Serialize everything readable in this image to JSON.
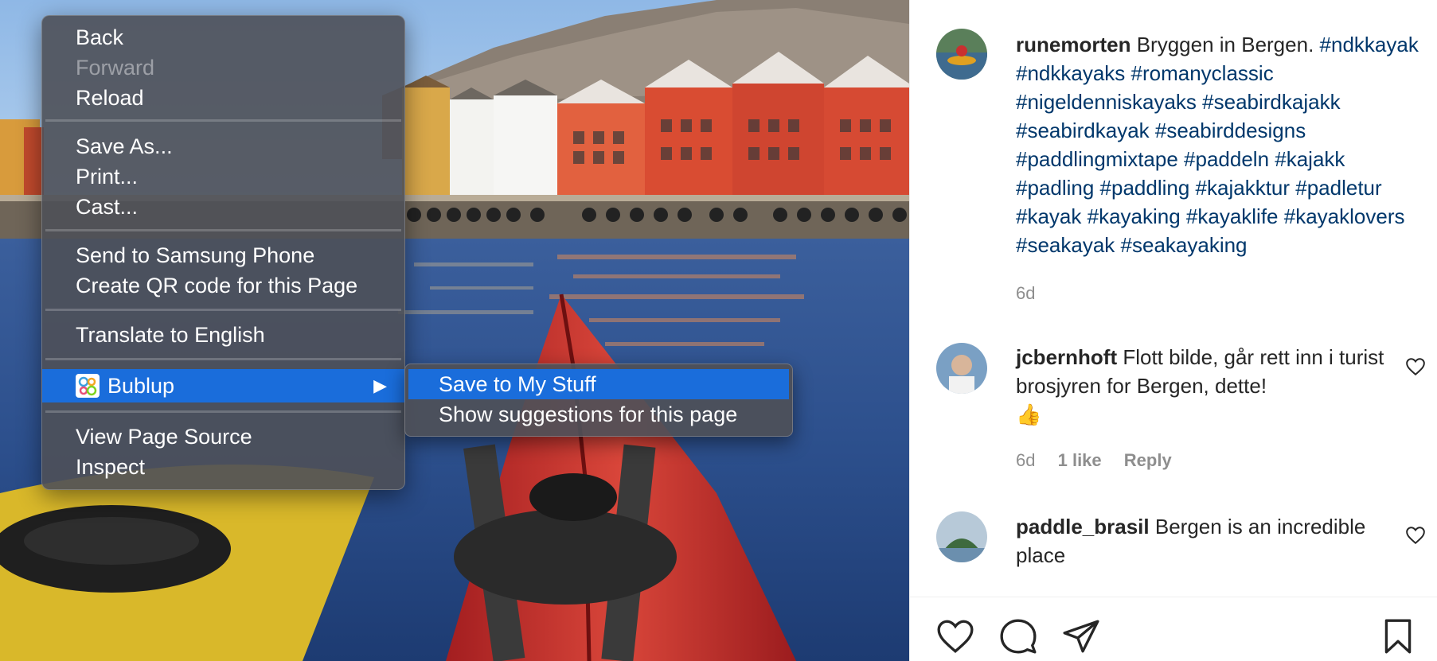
{
  "context_menu": {
    "items": [
      {
        "label": "Back"
      },
      {
        "label": "Forward"
      },
      {
        "label": "Reload"
      },
      {
        "label": "Save As..."
      },
      {
        "label": "Print..."
      },
      {
        "label": "Cast..."
      },
      {
        "label": "Send to Samsung Phone"
      },
      {
        "label": "Create QR code for this Page"
      },
      {
        "label": "Translate to English"
      },
      {
        "label": "Bublup",
        "icon": "bublup-logo-icon",
        "submenu_arrow": "▶"
      },
      {
        "label": "View Page Source"
      },
      {
        "label": "Inspect"
      }
    ],
    "disabled": [
      "Forward"
    ],
    "selected": "Bublup",
    "submenu": {
      "items": [
        {
          "label": "Save to My Stuff"
        },
        {
          "label": "Show suggestions for this page"
        }
      ],
      "selected": "Save to My Stuff"
    },
    "colors": {
      "highlight": "#1a6ddb",
      "menu_bg": "#4e5058"
    }
  },
  "post": {
    "caption": {
      "username": "runemorten",
      "text": "Bryggen in Bergen.",
      "hashtags": "#ndkkayak #ndkkayaks #romanyclassic #nigeldenniskayaks #seabirdkajakk #seabirdkayak #seabirddesigns #paddlingmixtape #paddeln #kajakk #padling #paddling #kajakktur #padletur #kayak #kayaking #kayaklife #kayaklovers #seakayak #seakayaking"
    },
    "caption_time": "6d",
    "comments": [
      {
        "username": "jcbernhoft",
        "text": "Flott bilde, går rett inn i turist brosjyren for Bergen, dette!",
        "emoji": "👍",
        "time": "6d",
        "likes": "1 like",
        "reply": "Reply"
      },
      {
        "username": "paddle_brasil",
        "text": "Bergen is an incredible place"
      }
    ],
    "icons": {
      "like": "heart-icon",
      "comment": "comment-bubble-icon",
      "share": "paper-plane-icon",
      "save": "bookmark-icon",
      "comment_like": "heart-outline-icon"
    },
    "colors": {
      "hashtag": "#00376b",
      "text": "#262626",
      "meta": "#8e8e8e"
    }
  }
}
